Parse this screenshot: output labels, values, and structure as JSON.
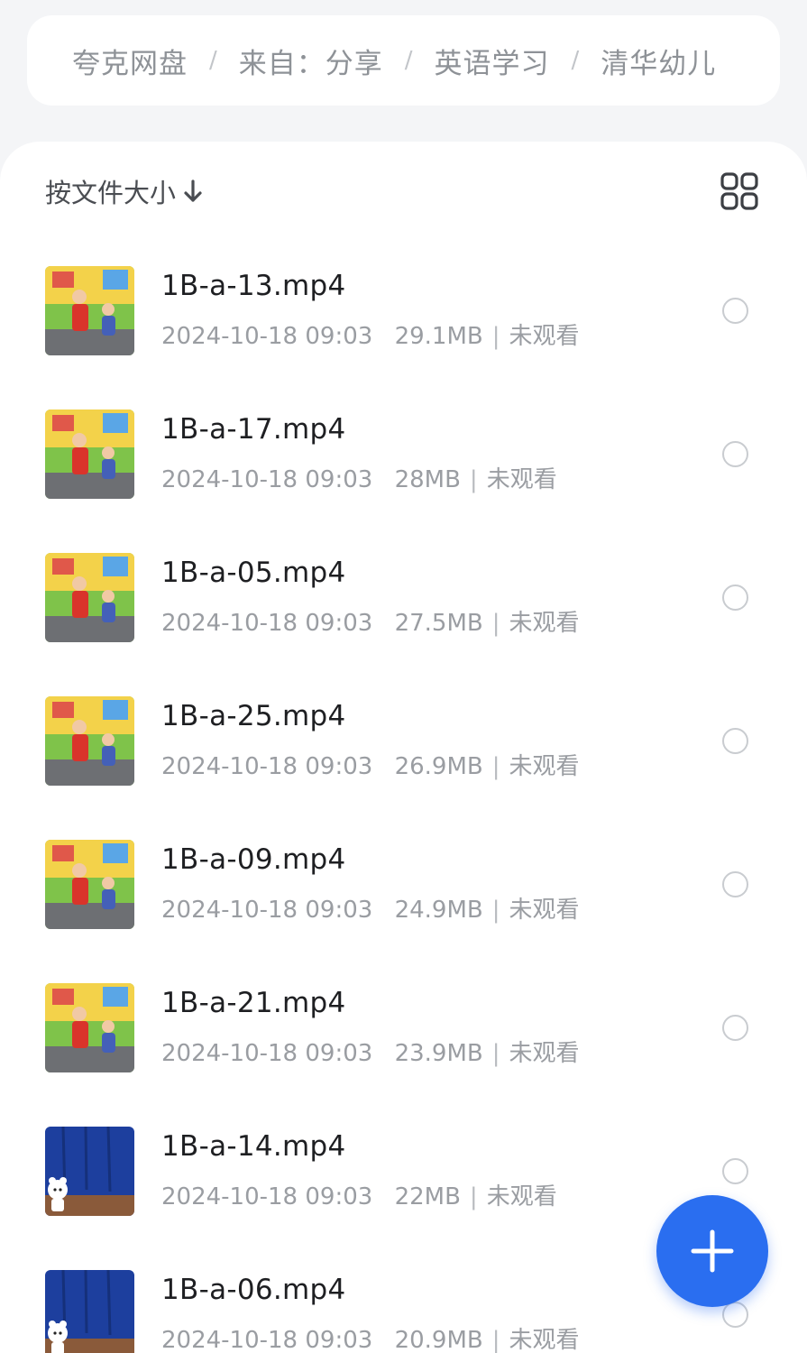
{
  "breadcrumb": {
    "items": [
      "夸克网盘",
      "来自：分享",
      "英语学习",
      "清华幼儿"
    ],
    "separator": "/"
  },
  "toolbar": {
    "sort_label": "按文件大小",
    "sort_icon": "arrow-down-icon",
    "view_toggle_icon": "grid-view-icon"
  },
  "files": [
    {
      "name": "1B-a-13.mp4",
      "date": "2024-10-18 09:03",
      "size": "29.1MB",
      "status": "未观看",
      "thumb": "scene-classroom"
    },
    {
      "name": "1B-a-17.mp4",
      "date": "2024-10-18 09:03",
      "size": "28MB",
      "status": "未观看",
      "thumb": "scene-classroom"
    },
    {
      "name": "1B-a-05.mp4",
      "date": "2024-10-18 09:03",
      "size": "27.5MB",
      "status": "未观看",
      "thumb": "scene-classroom"
    },
    {
      "name": "1B-a-25.mp4",
      "date": "2024-10-18 09:03",
      "size": "26.9MB",
      "status": "未观看",
      "thumb": "scene-classroom"
    },
    {
      "name": "1B-a-09.mp4",
      "date": "2024-10-18 09:03",
      "size": "24.9MB",
      "status": "未观看",
      "thumb": "scene-classroom"
    },
    {
      "name": "1B-a-21.mp4",
      "date": "2024-10-18 09:03",
      "size": "23.9MB",
      "status": "未观看",
      "thumb": "scene-classroom"
    },
    {
      "name": "1B-a-14.mp4",
      "date": "2024-10-18 09:03",
      "size": "22MB",
      "status": "未观看",
      "thumb": "scene-stage-bear"
    },
    {
      "name": "1B-a-06.mp4",
      "date": "2024-10-18 09:03",
      "size": "20.9MB",
      "status": "未观看",
      "thumb": "scene-stage-bear"
    }
  ],
  "fab": {
    "icon": "plus-icon"
  },
  "colors": {
    "accent": "#2a6ef0",
    "text_primary": "#1e1f22",
    "text_secondary": "#9a9da2",
    "page_bg": "#f4f5f7"
  }
}
